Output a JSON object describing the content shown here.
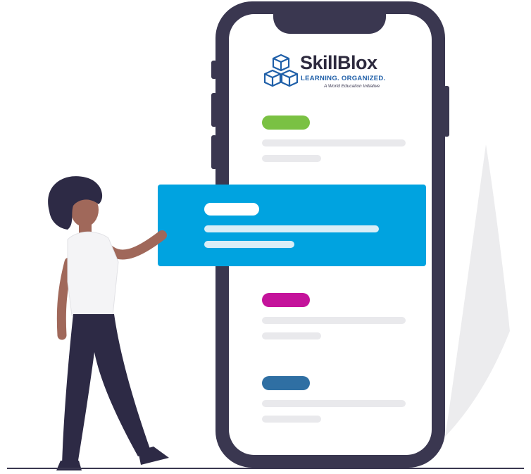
{
  "logo": {
    "name": "SkillBlox",
    "tagline": "LEARNING. ORGANIZED.",
    "subline": "A World Education Initiative"
  },
  "colors": {
    "phone_frame": "#3a3750",
    "item_1_accent": "#7ac143",
    "item_2_accent": "#c4139b",
    "item_3_accent": "#2f6fa3",
    "highlight_card": "#00a3e0"
  },
  "icons": [
    "blocks-logo-icon"
  ]
}
